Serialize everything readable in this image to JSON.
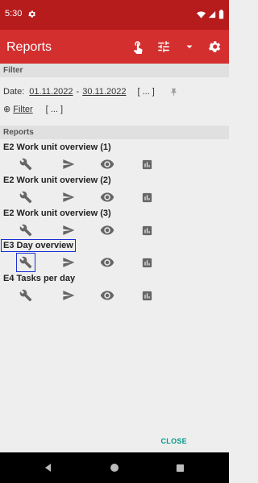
{
  "status_bar": {
    "time": "5:30"
  },
  "app_bar": {
    "title": "Reports",
    "icons": [
      "touch-icon",
      "sliders-icon",
      "dropdown-icon",
      "settings-icon"
    ]
  },
  "filter": {
    "header": "Filter",
    "date_label": "Date:",
    "date_from": "01.11.2022",
    "date_separator": "-",
    "date_to": "30.11.2022",
    "date_more": "[ ... ]",
    "filter_link": "Filter",
    "filter_more": "[ ... ]"
  },
  "reports": {
    "header": "Reports",
    "items": [
      {
        "title": "E2 Work unit overview (1)"
      },
      {
        "title": "E2 Work unit overview (2)"
      },
      {
        "title": "E2 Work unit overview (3)"
      },
      {
        "title": "E3 Day overview"
      },
      {
        "title": "E4 Tasks per day"
      }
    ],
    "action_icons": [
      "wrench-icon",
      "send-icon",
      "eye-icon",
      "chart-icon"
    ]
  },
  "dialog": {
    "close_label": "CLOSE"
  },
  "colors": {
    "status_bar": "#b71c1c",
    "app_bar": "#d32f2f",
    "accent": "#009688",
    "highlight": "#1a2fd6"
  }
}
